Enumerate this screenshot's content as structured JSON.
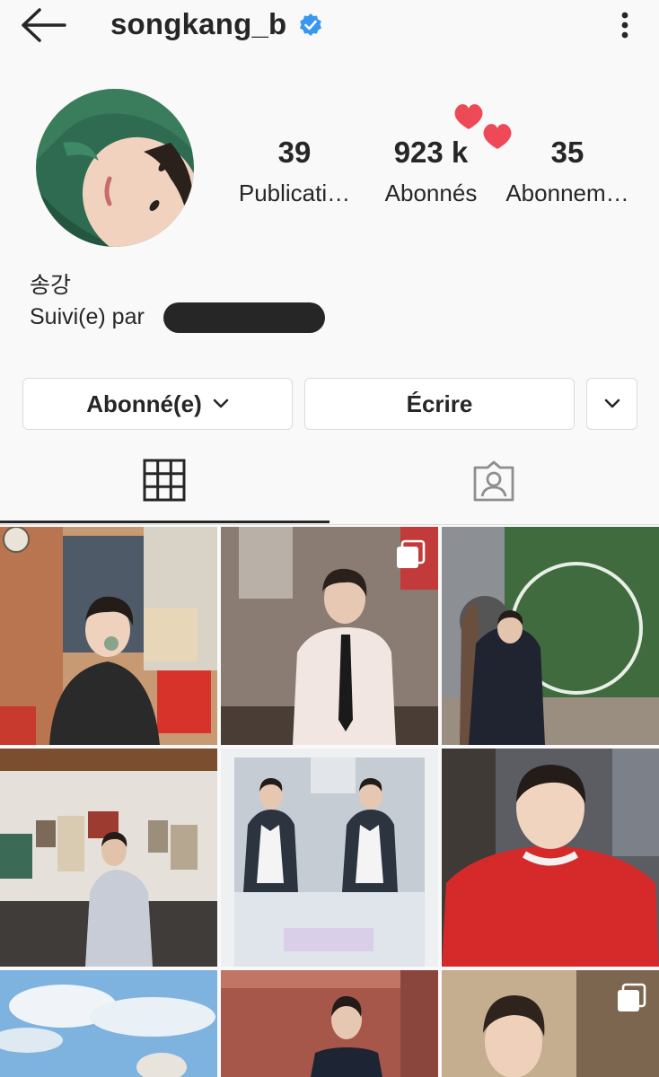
{
  "header": {
    "username": "songkang_b",
    "verified_icon": "verified-badge-icon",
    "back_icon": "arrow-left-icon",
    "more_icon": "more-vertical-icon"
  },
  "profile": {
    "stats": [
      {
        "value": "39",
        "label": "Publicati…"
      },
      {
        "value": "923 k",
        "label": "Abonnés"
      },
      {
        "value": "35",
        "label": "Abonnem…"
      }
    ],
    "full_name": "송강",
    "followed_by_label": "Suivi(e) par"
  },
  "actions": {
    "following_label": "Abonné(e)",
    "message_label": "Écrire"
  },
  "tabs": {
    "active": "grid",
    "icons": [
      "grid-icon",
      "tagged-icon"
    ]
  },
  "posts": [
    {
      "id": 1,
      "multi": false
    },
    {
      "id": 2,
      "multi": true
    },
    {
      "id": 3,
      "multi": false
    },
    {
      "id": 4,
      "multi": false
    },
    {
      "id": 5,
      "multi": false
    },
    {
      "id": 6,
      "multi": false
    },
    {
      "id": 7,
      "multi": false
    },
    {
      "id": 8,
      "multi": false
    },
    {
      "id": 9,
      "multi": true
    }
  ],
  "colors": {
    "verified": "#3897f0",
    "heart": "#ed4956",
    "text": "#262626",
    "border": "#dbdbdb"
  }
}
